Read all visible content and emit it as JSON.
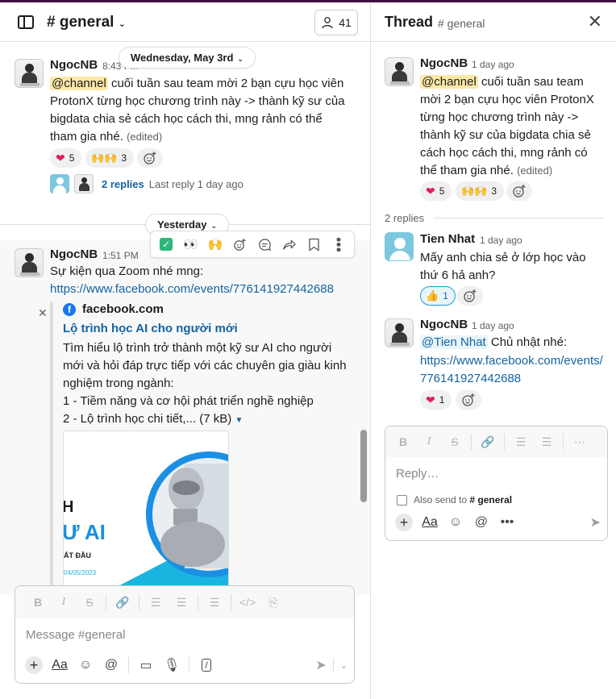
{
  "channel": {
    "name": "# general",
    "member_count": "41",
    "earlier_date": "Wednesday, May 3rd",
    "recent_date": "Yesterday",
    "msg1": {
      "sender": "NgocNB",
      "time": "8:43 PM",
      "mention": "@channel",
      "text": " cuối tuần sau team mời 2 bạn cựu học viên ProtonX từng học chương trình này -> thành kỹ sư của bigdata chia sẻ cách học cách thi, mng rảnh có thể tham gia nhé.",
      "edited": "(edited)",
      "reactions": [
        {
          "emoji": "❤",
          "count": "5"
        },
        {
          "emoji": "🙌🙌",
          "count": "3"
        }
      ],
      "replies_label": "2 replies",
      "last_reply": "Last reply 1 day ago"
    },
    "msg2": {
      "sender": "NgocNB",
      "time": "1:51 PM",
      "text": "Sự kiện qua Zoom nhé mng:",
      "url": "https://www.facebook.com/events/776141927442688",
      "unfurl": {
        "site": "facebook.com",
        "title": "Lộ trình học AI cho người mới",
        "description": "Tìm hiểu lộ trình trở thành một kỹ sư AI cho người mới và hỏi đáp trực tiếp với các chuyên gia giàu kinh nghiệm trong ngành:",
        "item1": "1 - Tiềm năng và cơ hội phát triển nghề nghiệp",
        "item2": "2 - Lộ trình học chi tiết,... (7 kB)",
        "image_text1": "H",
        "image_text2": "Ư AI",
        "image_text3": "ẮT ĐẦU",
        "image_text4": "04/05/2023"
      }
    },
    "composer_placeholder": "Message #general"
  },
  "thread": {
    "title": "Thread",
    "channel": "# general",
    "parent": {
      "sender": "NgocNB",
      "time": "1 day ago",
      "mention": "@channel",
      "text": " cuối tuần sau team mời 2 bạn cựu học viên ProtonX từng học chương trình này -> thành kỹ sư của bigdata chia sẻ cách học cách thi, mng rảnh có thể tham gia nhé.",
      "edited": "(edited)",
      "reactions": [
        {
          "emoji": "❤",
          "count": "5"
        },
        {
          "emoji": "🙌🙌",
          "count": "3"
        }
      ]
    },
    "replies_label": "2 replies",
    "reply1": {
      "sender": "Tien Nhat",
      "time": "1 day ago",
      "text": "Mấy anh chia sẻ ở lớp học vào thứ 6 hả anh?",
      "reaction": {
        "emoji": "👍",
        "count": "1"
      }
    },
    "reply2": {
      "sender": "NgocNB",
      "time": "1 day ago",
      "mention": "@Tien Nhat",
      "text": " Chủ nhật nhé:",
      "url": "https://www.facebook.com/events/776141927442688",
      "reaction": {
        "emoji": "❤",
        "count": "1"
      }
    },
    "composer_placeholder": "Reply…",
    "also_send_prefix": "Also send to",
    "also_send_channel": "# general"
  },
  "colors": {
    "link": "#1264a3",
    "mention_bg": "#fde8a8",
    "heart": "#e01e5a",
    "accent_active": "#1d9bd1",
    "top_bar": "#3f0e40"
  }
}
